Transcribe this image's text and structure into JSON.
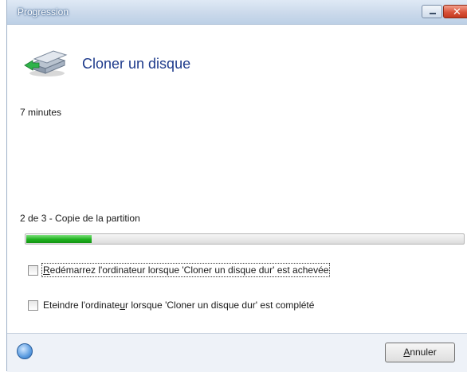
{
  "window": {
    "title": "Progression"
  },
  "header": {
    "title": "Cloner un disque",
    "icon": "disk-clone-icon"
  },
  "time_remaining": "7 minutes",
  "step": "2 de 3 - Copie de la partition",
  "progress": {
    "fraction": 0.15,
    "color": "#1fb21f"
  },
  "options": [
    {
      "pre": "",
      "underlined": "R",
      "post": "edémarrez l'ordinateur lorsque 'Cloner un disque dur' est achevée",
      "checked": false
    },
    {
      "pre": "Eteindre l'ordinate",
      "underlined": "u",
      "post": "r lorsque 'Cloner un disque dur' est complété",
      "checked": false
    }
  ],
  "footer": {
    "cancel": {
      "underlined": "A",
      "rest": "nnuler"
    },
    "help_icon": "help-icon"
  }
}
